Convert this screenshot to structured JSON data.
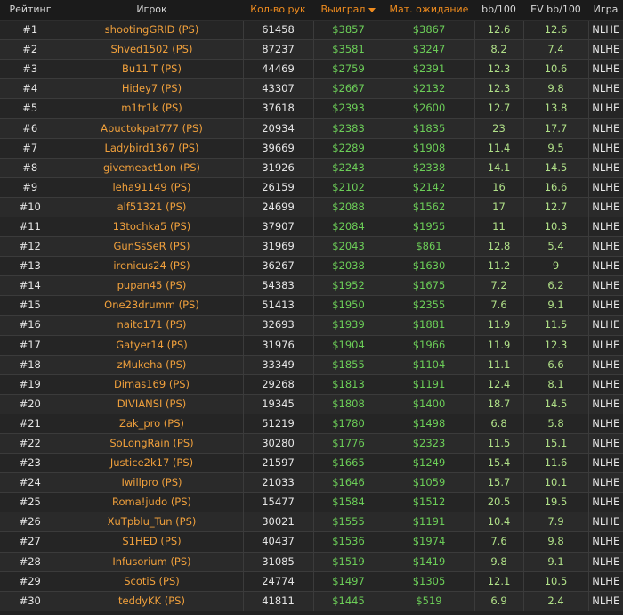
{
  "headers": {
    "rank": "Рейтинг",
    "player": "Игрок",
    "hands": "Кол-во рук",
    "won": "Выиграл",
    "ev": "Мат. ожидание",
    "bb100": "bb/100",
    "evbb100": "EV bb/100",
    "game": "Игра"
  },
  "rows": [
    {
      "rank": "#1",
      "player": "shootingGRID (PS)",
      "hands": "61458",
      "won": "$3857",
      "ev": "$3867",
      "bb": "12.6",
      "evbb": "12.6",
      "game": "NLHE"
    },
    {
      "rank": "#2",
      "player": "Shved1502 (PS)",
      "hands": "87237",
      "won": "$3581",
      "ev": "$3247",
      "bb": "8.2",
      "evbb": "7.4",
      "game": "NLHE"
    },
    {
      "rank": "#3",
      "player": "Bu11iT (PS)",
      "hands": "44469",
      "won": "$2759",
      "ev": "$2391",
      "bb": "12.3",
      "evbb": "10.6",
      "game": "NLHE"
    },
    {
      "rank": "#4",
      "player": "Hidey7 (PS)",
      "hands": "43307",
      "won": "$2667",
      "ev": "$2132",
      "bb": "12.3",
      "evbb": "9.8",
      "game": "NLHE"
    },
    {
      "rank": "#5",
      "player": "m1tr1k (PS)",
      "hands": "37618",
      "won": "$2393",
      "ev": "$2600",
      "bb": "12.7",
      "evbb": "13.8",
      "game": "NLHE"
    },
    {
      "rank": "#6",
      "player": "Apuctokpat777 (PS)",
      "hands": "20934",
      "won": "$2383",
      "ev": "$1835",
      "bb": "23",
      "evbb": "17.7",
      "game": "NLHE"
    },
    {
      "rank": "#7",
      "player": "Ladybird1367 (PS)",
      "hands": "39669",
      "won": "$2289",
      "ev": "$1908",
      "bb": "11.4",
      "evbb": "9.5",
      "game": "NLHE"
    },
    {
      "rank": "#8",
      "player": "givemeact1on (PS)",
      "hands": "31926",
      "won": "$2243",
      "ev": "$2338",
      "bb": "14.1",
      "evbb": "14.5",
      "game": "NLHE"
    },
    {
      "rank": "#9",
      "player": "leha91149 (PS)",
      "hands": "26159",
      "won": "$2102",
      "ev": "$2142",
      "bb": "16",
      "evbb": "16.6",
      "game": "NLHE"
    },
    {
      "rank": "#10",
      "player": "alf51321 (PS)",
      "hands": "24699",
      "won": "$2088",
      "ev": "$1562",
      "bb": "17",
      "evbb": "12.7",
      "game": "NLHE"
    },
    {
      "rank": "#11",
      "player": "13tochka5 (PS)",
      "hands": "37907",
      "won": "$2084",
      "ev": "$1955",
      "bb": "11",
      "evbb": "10.3",
      "game": "NLHE"
    },
    {
      "rank": "#12",
      "player": "GunSsSeR (PS)",
      "hands": "31969",
      "won": "$2043",
      "ev": "$861",
      "bb": "12.8",
      "evbb": "5.4",
      "game": "NLHE"
    },
    {
      "rank": "#13",
      "player": "irenicus24 (PS)",
      "hands": "36267",
      "won": "$2038",
      "ev": "$1630",
      "bb": "11.2",
      "evbb": "9",
      "game": "NLHE"
    },
    {
      "rank": "#14",
      "player": "pupan45 (PS)",
      "hands": "54383",
      "won": "$1952",
      "ev": "$1675",
      "bb": "7.2",
      "evbb": "6.2",
      "game": "NLHE"
    },
    {
      "rank": "#15",
      "player": "One23drumm (PS)",
      "hands": "51413",
      "won": "$1950",
      "ev": "$2355",
      "bb": "7.6",
      "evbb": "9.1",
      "game": "NLHE"
    },
    {
      "rank": "#16",
      "player": "naito171 (PS)",
      "hands": "32693",
      "won": "$1939",
      "ev": "$1881",
      "bb": "11.9",
      "evbb": "11.5",
      "game": "NLHE"
    },
    {
      "rank": "#17",
      "player": "Gatyer14 (PS)",
      "hands": "31976",
      "won": "$1904",
      "ev": "$1966",
      "bb": "11.9",
      "evbb": "12.3",
      "game": "NLHE"
    },
    {
      "rank": "#18",
      "player": "zMukeha (PS)",
      "hands": "33349",
      "won": "$1855",
      "ev": "$1104",
      "bb": "11.1",
      "evbb": "6.6",
      "game": "NLHE"
    },
    {
      "rank": "#19",
      "player": "Dimas169 (PS)",
      "hands": "29268",
      "won": "$1813",
      "ev": "$1191",
      "bb": "12.4",
      "evbb": "8.1",
      "game": "NLHE"
    },
    {
      "rank": "#20",
      "player": "DIVIANSI (PS)",
      "hands": "19345",
      "won": "$1808",
      "ev": "$1400",
      "bb": "18.7",
      "evbb": "14.5",
      "game": "NLHE"
    },
    {
      "rank": "#21",
      "player": "Zak_pro (PS)",
      "hands": "51219",
      "won": "$1780",
      "ev": "$1498",
      "bb": "6.8",
      "evbb": "5.8",
      "game": "NLHE"
    },
    {
      "rank": "#22",
      "player": "SoLongRain (PS)",
      "hands": "30280",
      "won": "$1776",
      "ev": "$2323",
      "bb": "11.5",
      "evbb": "15.1",
      "game": "NLHE"
    },
    {
      "rank": "#23",
      "player": "Justice2k17 (PS)",
      "hands": "21597",
      "won": "$1665",
      "ev": "$1249",
      "bb": "15.4",
      "evbb": "11.6",
      "game": "NLHE"
    },
    {
      "rank": "#24",
      "player": "Iwillpro (PS)",
      "hands": "21033",
      "won": "$1646",
      "ev": "$1059",
      "bb": "15.7",
      "evbb": "10.1",
      "game": "NLHE"
    },
    {
      "rank": "#25",
      "player": "Roma!judo (PS)",
      "hands": "15477",
      "won": "$1584",
      "ev": "$1512",
      "bb": "20.5",
      "evbb": "19.5",
      "game": "NLHE"
    },
    {
      "rank": "#26",
      "player": "XuTpblu_Tun (PS)",
      "hands": "30021",
      "won": "$1555",
      "ev": "$1191",
      "bb": "10.4",
      "evbb": "7.9",
      "game": "NLHE"
    },
    {
      "rank": "#27",
      "player": "S1HED (PS)",
      "hands": "40437",
      "won": "$1536",
      "ev": "$1974",
      "bb": "7.6",
      "evbb": "9.8",
      "game": "NLHE"
    },
    {
      "rank": "#28",
      "player": "Infusorium (PS)",
      "hands": "31085",
      "won": "$1519",
      "ev": "$1419",
      "bb": "9.8",
      "evbb": "9.1",
      "game": "NLHE"
    },
    {
      "rank": "#29",
      "player": "ScotiS (PS)",
      "hands": "24774",
      "won": "$1497",
      "ev": "$1305",
      "bb": "12.1",
      "evbb": "10.5",
      "game": "NLHE"
    },
    {
      "rank": "#30",
      "player": "teddyKK (PS)",
      "hands": "41811",
      "won": "$1445",
      "ev": "$519",
      "bb": "6.9",
      "evbb": "2.4",
      "game": "NLHE"
    }
  ]
}
